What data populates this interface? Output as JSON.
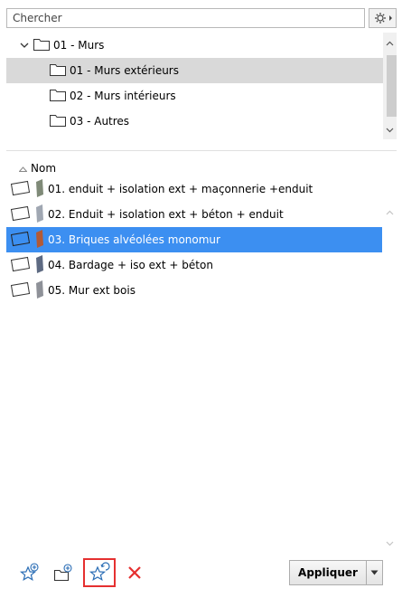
{
  "search": {
    "placeholder": "Chercher",
    "value": ""
  },
  "settings_icon": "gear-icon",
  "tree": {
    "items": [
      {
        "label": "01 - Murs",
        "expanded": true,
        "selected": false
      },
      {
        "label": "01 - Murs extérieurs",
        "selected": true
      },
      {
        "label": "02 - Murs intérieurs",
        "selected": false
      },
      {
        "label": "03 - Autres",
        "selected": false
      }
    ]
  },
  "list": {
    "column_header": "Nom",
    "items": [
      {
        "label": "01. enduit + isolation ext + maçonnerie +enduit",
        "swatch": "#7f8a78",
        "selected": false
      },
      {
        "label": "02. Enduit + isolation ext + béton + enduit",
        "swatch": "#a0a7b2",
        "selected": false
      },
      {
        "label": "03. Briques alvéolées monomur",
        "swatch": "#b35a36",
        "selected": true
      },
      {
        "label": "04. Bardage + iso ext + béton",
        "swatch": "#5d6a82",
        "selected": false
      },
      {
        "label": "05. Mur ext bois",
        "swatch": "#8e9198",
        "selected": false
      }
    ]
  },
  "toolbar": {
    "apply_label": "Appliquer",
    "accent_color": "#3c8ff1",
    "delete_color": "#e53030"
  }
}
